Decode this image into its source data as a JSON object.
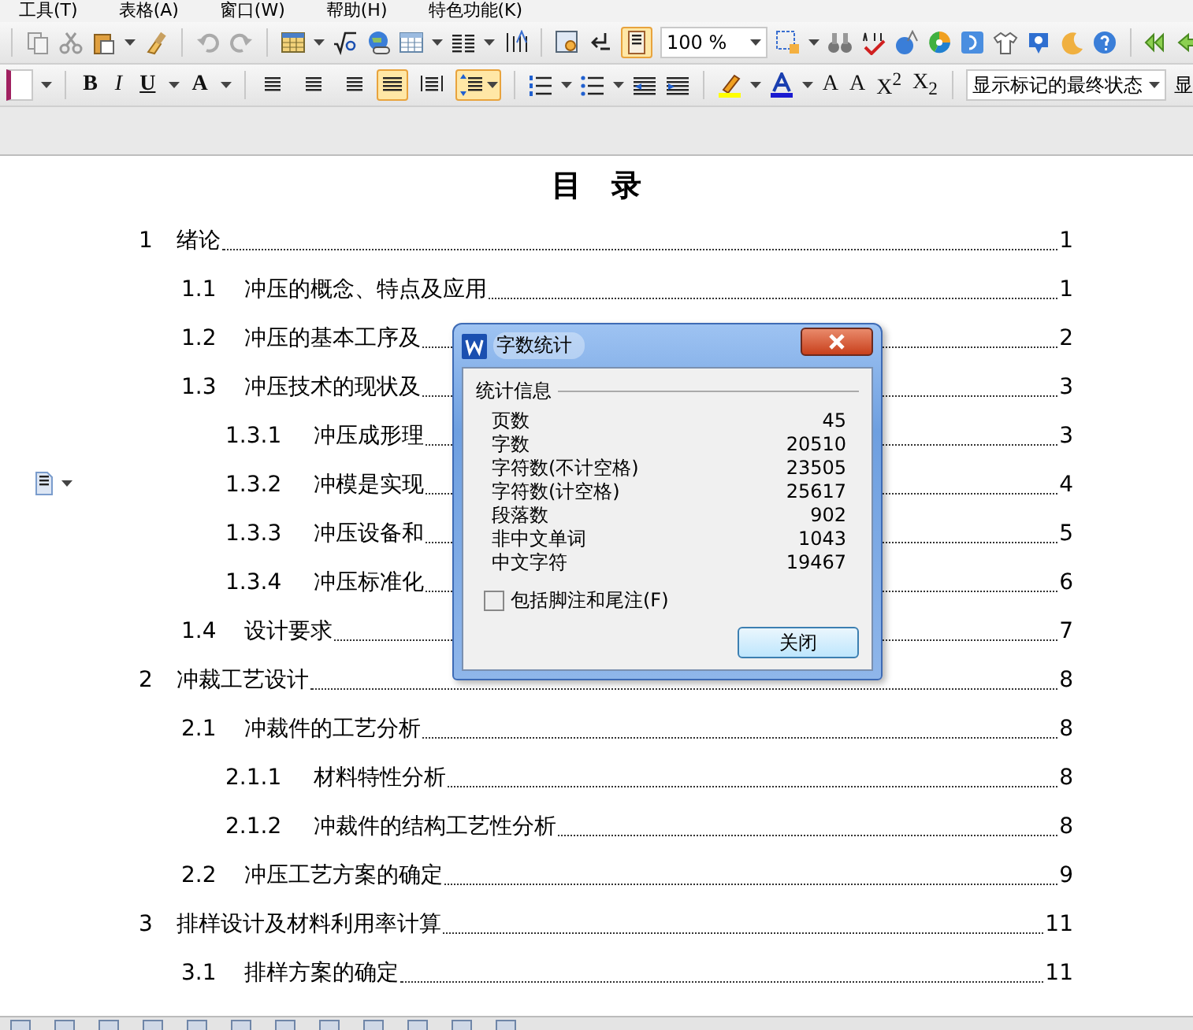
{
  "menu": [
    {
      "label": "工具(T)"
    },
    {
      "label": "表格(A)"
    },
    {
      "label": "窗口(W)"
    },
    {
      "label": "帮助(H)"
    },
    {
      "label": "特色功能(K)"
    }
  ],
  "page_view": {
    "selected": true
  },
  "zoom_field": {
    "value": "100 %"
  },
  "format_buttons": [
    {
      "label": "B"
    },
    {
      "label": "I"
    },
    {
      "label": "U"
    },
    {
      "label": "A"
    }
  ],
  "align_buttons": [
    {
      "selected": false
    },
    {
      "selected": false
    },
    {
      "selected": false
    },
    {
      "selected": true
    },
    {
      "selected": false
    }
  ],
  "line_spacing": {
    "selected": true
  },
  "font_size_buttons": [
    {
      "label": "A"
    },
    {
      "label": "A"
    },
    {
      "label": "X$^{2}$"
    },
    {
      "label": "X$_{2}$"
    }
  ],
  "markup_dropdown": {
    "value": "显示标记的最终状态"
  },
  "markup_cut": "显",
  "document": {
    "title": "目　录",
    "toc": [
      {
        "number": "1",
        "title": "绪论",
        "page": "1",
        "children": [
          {
            "number": "1.1",
            "title": "冲压的概念、特点及应用",
            "page": "1"
          },
          {
            "number": "1.2",
            "title": "冲压的基本工序及",
            "page": "2"
          },
          {
            "number": "1.3",
            "title": "冲压技术的现状及",
            "page": "3",
            "children": [
              {
                "number": "1.3.1",
                "title": "冲压成形理",
                "page": "3"
              },
              {
                "number": "1.3.2",
                "title": "冲模是实现",
                "page": "4"
              },
              {
                "number": "1.3.3",
                "title": "冲压设备和",
                "page": "5"
              },
              {
                "number": "1.3.4",
                "title": "冲压标准化",
                "page": "6"
              }
            ]
          },
          {
            "number": "1.4",
            "title": "设计要求",
            "page": "7"
          }
        ]
      },
      {
        "number": "2",
        "title": "冲裁工艺设计",
        "page": "8",
        "children": [
          {
            "number": "2.1",
            "title": "冲裁件的工艺分析",
            "page": "8",
            "children": [
              {
                "number": "2.1.1",
                "title": "材料特性分析",
                "page": "8"
              },
              {
                "number": "2.1.2",
                "title": "冲裁件的结构工艺性分析",
                "page": "8"
              }
            ]
          },
          {
            "number": "2.2",
            "title": "冲压工艺方案的确定",
            "page": "9"
          }
        ]
      },
      {
        "number": "3",
        "title": "排样设计及材料利用率计算",
        "page": "11",
        "children": [
          {
            "number": "3.1",
            "title": "排样方案的确定",
            "page": "11"
          }
        ]
      }
    ]
  },
  "dialog": {
    "title": "字数统计",
    "group": "统计信息",
    "stats": [
      {
        "label": "页数",
        "value": "45"
      },
      {
        "label": "字数",
        "value": "20510"
      },
      {
        "label": "字符数(不计空格)",
        "value": "23505"
      },
      {
        "label": "字符数(计空格)",
        "value": "25617"
      },
      {
        "label": "段落数",
        "value": "902"
      },
      {
        "label": "非中文单词",
        "value": "1043"
      },
      {
        "label": "中文字符",
        "value": "19467"
      }
    ],
    "checkbox": {
      "label": "包括脚注和尾注(F)",
      "checked": false
    },
    "button": "关闭"
  }
}
